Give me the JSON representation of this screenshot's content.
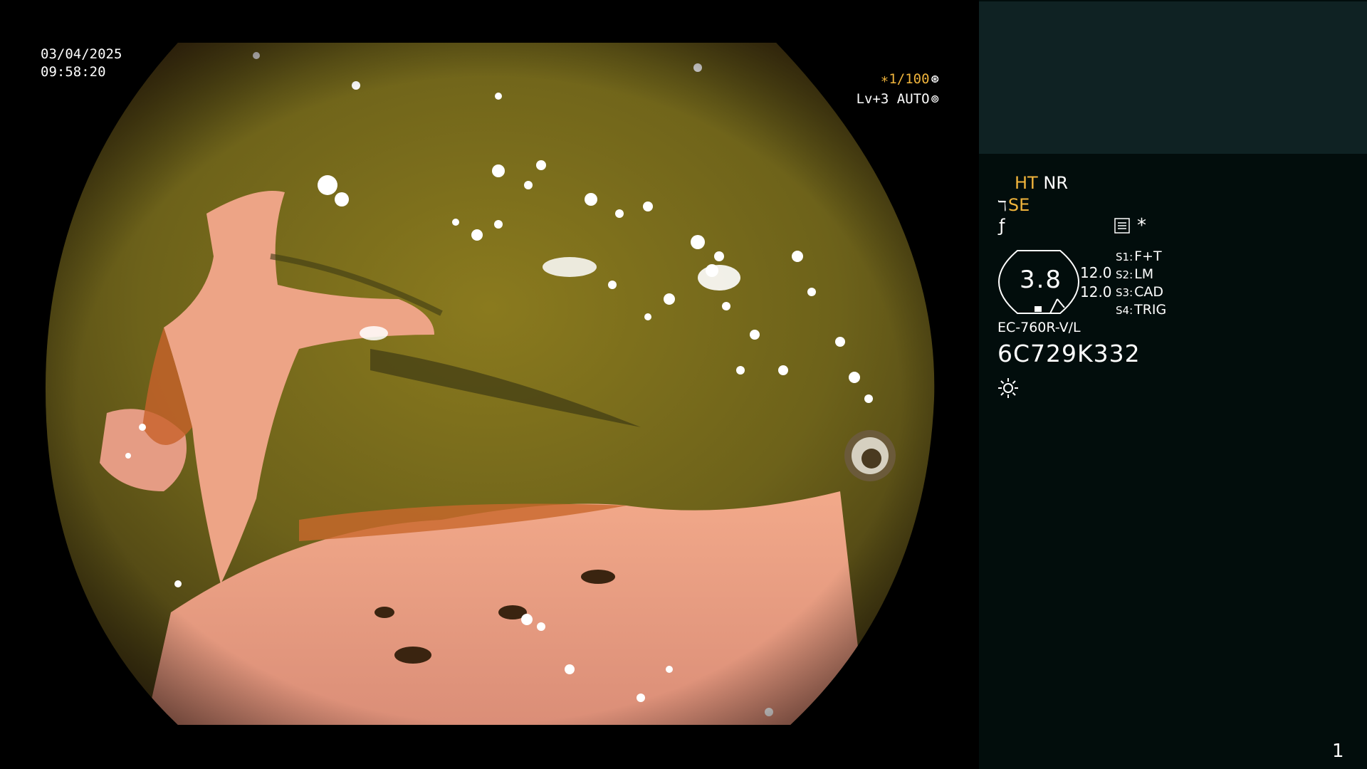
{
  "overlay": {
    "date": "03/04/2025",
    "time": "09:58:20",
    "shutter": "∗1/100",
    "shutter_icon": "aperture-icon",
    "level": "Lv+3 AUTO",
    "level_icon": "auto-exposure-icon"
  },
  "panel": {
    "ht_label": "HT",
    "nr_label": "NR",
    "se_label": "SE",
    "se_icon": "structure-enhance-icon",
    "fnum_icon": "f-icon",
    "menu_icon": "settings-list-icon",
    "asterisk": "*",
    "gauge_value": "3.8",
    "values": [
      "12.0",
      "12.0"
    ],
    "switches": [
      {
        "key": "S1:",
        "value": "F+T"
      },
      {
        "key": "S2:",
        "value": "LM"
      },
      {
        "key": "S3:",
        "value": "CAD"
      },
      {
        "key": "S4:",
        "value": "TRIG"
      }
    ],
    "model": "EC-760R-V/L",
    "serial": "6C729K332",
    "lamp_icon": "lamp-icon",
    "page_number": "1"
  },
  "colors": {
    "accent": "#f0b43c",
    "panel_top": "#0f2223",
    "panel_bg": "#020d0c"
  }
}
